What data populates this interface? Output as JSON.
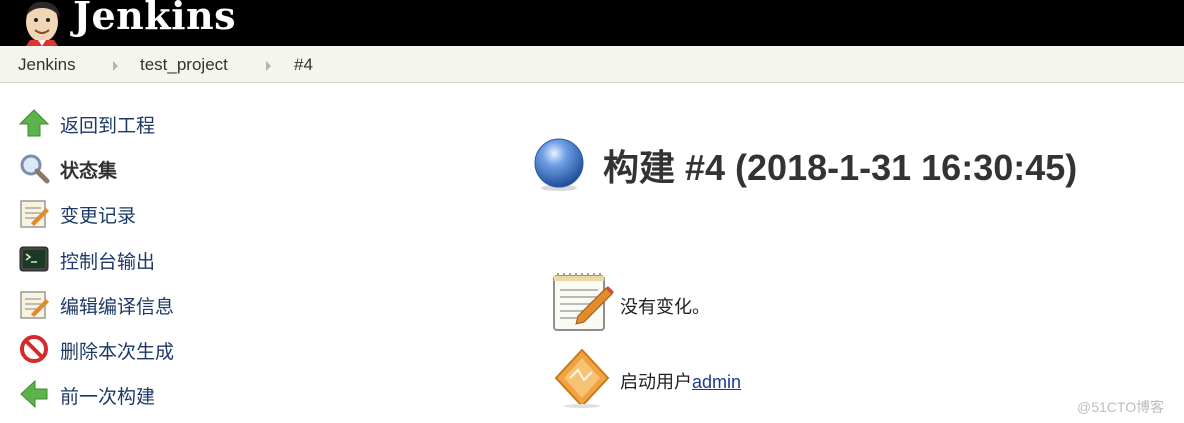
{
  "header": {
    "title": "Jenkins",
    "logo_icon": "jenkins-butler-icon"
  },
  "breadcrumb": {
    "items": [
      "Jenkins",
      "test_project",
      "#4"
    ]
  },
  "sidebar": {
    "items": [
      {
        "label": "返回到工程",
        "icon": "up-arrow-icon"
      },
      {
        "label": "状态集",
        "icon": "magnifier-icon",
        "current": true
      },
      {
        "label": "变更记录",
        "icon": "notepad-icon"
      },
      {
        "label": "控制台输出",
        "icon": "terminal-icon"
      },
      {
        "label": "编辑编译信息",
        "icon": "notepad-icon"
      },
      {
        "label": "删除本次生成",
        "icon": "no-entry-icon"
      },
      {
        "label": "前一次构建",
        "icon": "left-arrow-icon"
      }
    ]
  },
  "main": {
    "build_title": "构建 #4 (2018-1-31 16:30:45)",
    "status_icon": "blue-ball-icon",
    "changes_text": "没有变化。",
    "started_by_prefix": "启动用户",
    "started_by_user": "admin"
  },
  "watermark": "@51CTO博客",
  "colors": {
    "header_bg": "#000000",
    "breadcrumb_bg": "#f4f6ee",
    "link": "#1d3a66",
    "status_blue": "#3a6fc4"
  }
}
